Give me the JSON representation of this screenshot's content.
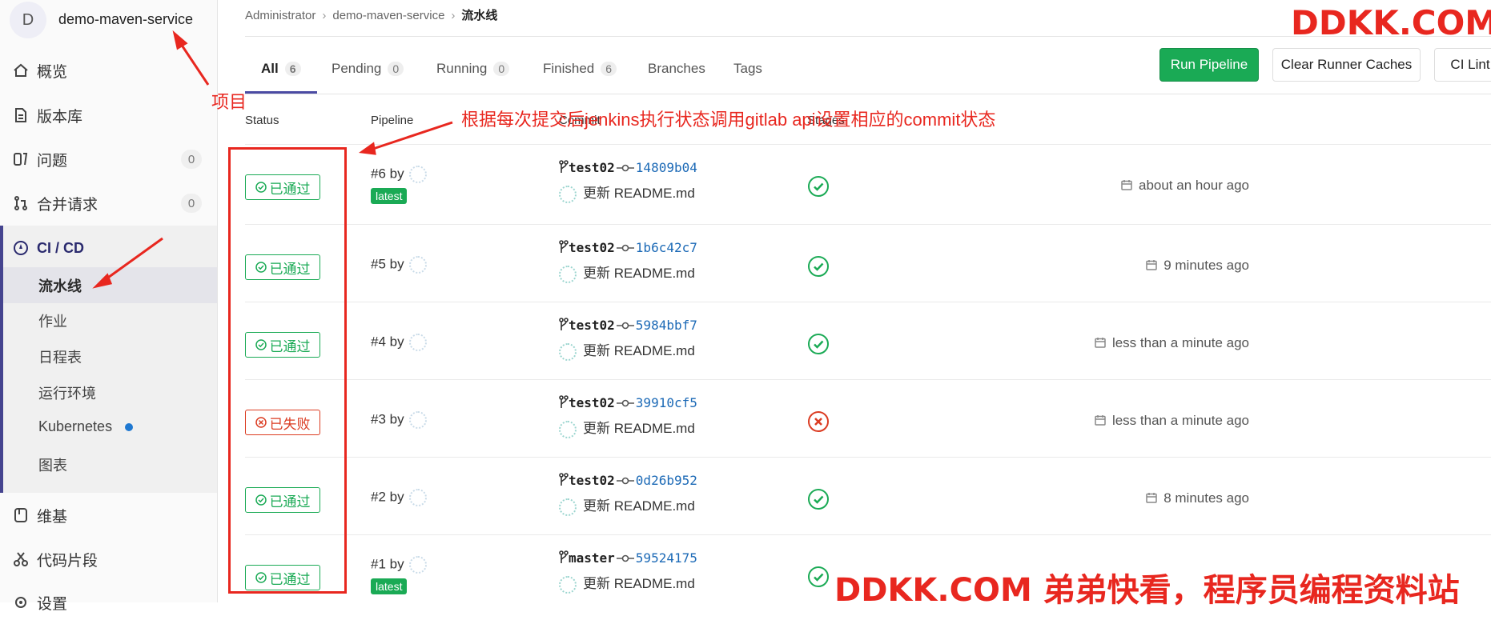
{
  "project": {
    "avatar_letter": "D",
    "name": "demo-maven-service"
  },
  "sidebar": {
    "items": [
      {
        "label": "概览",
        "icon": "home-icon"
      },
      {
        "label": "版本库",
        "icon": "doc-icon"
      },
      {
        "label": "问题",
        "icon": "issues-icon",
        "count": "0"
      },
      {
        "label": "合并请求",
        "icon": "merge-request-icon",
        "count": "0"
      },
      {
        "label": "CI / CD",
        "icon": "rocket-icon"
      },
      {
        "label": "维基",
        "icon": "book-icon"
      },
      {
        "label": "代码片段",
        "icon": "scissors-icon"
      },
      {
        "label": "设置",
        "icon": "gear-icon"
      }
    ],
    "cicd_sub": [
      "流水线",
      "作业",
      "日程表",
      "运行环境",
      "Kubernetes",
      "图表"
    ]
  },
  "breadcrumb": {
    "root": "Administrator",
    "project": "demo-maven-service",
    "current": "流水线"
  },
  "tabs": [
    {
      "label": "All",
      "count": "6"
    },
    {
      "label": "Pending",
      "count": "0"
    },
    {
      "label": "Running",
      "count": "0"
    },
    {
      "label": "Finished",
      "count": "6"
    },
    {
      "label": "Branches"
    },
    {
      "label": "Tags"
    }
  ],
  "buttons": {
    "run": "Run Pipeline",
    "clear": "Clear Runner Caches",
    "lint": "CI Lint"
  },
  "columns": {
    "status": "Status",
    "pipeline": "Pipeline",
    "commit": "Commit",
    "stages": "Stages"
  },
  "rows": [
    {
      "status": "已通过",
      "state": "passed",
      "id": "#6 by",
      "latest": "latest",
      "branch": "test02",
      "sha": "14809b04",
      "msg": "更新 README.md",
      "time": "about an hour ago"
    },
    {
      "status": "已通过",
      "state": "passed",
      "id": "#5 by",
      "latest": "",
      "branch": "test02",
      "sha": "1b6c42c7",
      "msg": "更新 README.md",
      "time": "9 minutes ago"
    },
    {
      "status": "已通过",
      "state": "passed",
      "id": "#4 by",
      "latest": "",
      "branch": "test02",
      "sha": "5984bbf7",
      "msg": "更新 README.md",
      "time": "less than a minute ago"
    },
    {
      "status": "已失败",
      "state": "failed",
      "id": "#3 by",
      "latest": "",
      "branch": "test02",
      "sha": "39910cf5",
      "msg": "更新 README.md",
      "time": "less than a minute ago"
    },
    {
      "status": "已通过",
      "state": "passed",
      "id": "#2 by",
      "latest": "",
      "branch": "test02",
      "sha": "0d26b952",
      "msg": "更新 README.md",
      "time": "8 minutes ago"
    },
    {
      "status": "已通过",
      "state": "passed",
      "id": "#1 by",
      "latest": "latest",
      "branch": "master",
      "sha": "59524175",
      "msg": "更新 README.md",
      "time": ""
    }
  ],
  "annotations": {
    "project_label": "项目",
    "note": "根据每次提交后jenkins执行状态调用gitlab api设置相应的commit状态",
    "watermark_top": "DDKK.COM",
    "watermark_bottom": "DDKK.COM 弟弟快看，程序员编程资料站"
  },
  "colors": {
    "success": "#1aaa55",
    "failed": "#db3b21",
    "annotation": "#e8271f",
    "link": "#1b69b6",
    "nav_accent": "#45448f"
  }
}
